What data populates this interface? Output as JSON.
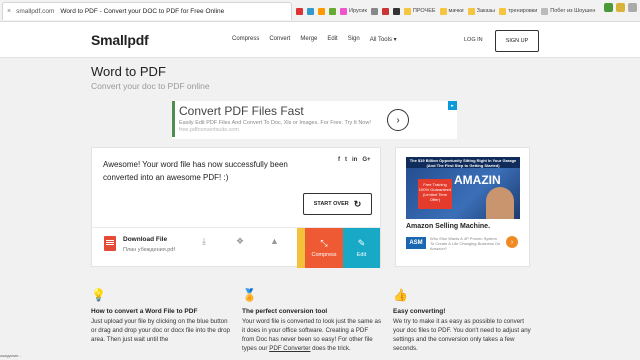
{
  "browser": {
    "tab_close": "×",
    "url": "smallpdf.com",
    "tab_title": "Word to PDF - Convert your DOC to PDF for Free Online",
    "bookmarks": [
      "Ирусик",
      "ПРОЧЕЕ",
      "мачки",
      "Заказы",
      "тренировки",
      "Побег из Шоушен"
    ]
  },
  "site": {
    "logo": "Smallpdf",
    "nav": [
      "Compress",
      "Convert",
      "Merge",
      "Edit",
      "Sign",
      "All Tools ▾"
    ],
    "login": "LOG IN",
    "signup": "SIGN UP"
  },
  "page": {
    "title": "Word to PDF",
    "subtitle": "Convert your doc to PDF online"
  },
  "ad": {
    "title": "Convert PDF Files Fast",
    "desc": "Easily Edit PDF Files And Convert To Doc, Xls or Images. For Free. Try It Now!",
    "source": "free.pdfconvertsuits.com",
    "badge": "▸"
  },
  "result": {
    "message": "Awesome! Your word file has now successfully been converted into an awesome PDF! :)",
    "share": [
      "f",
      "t",
      "in",
      "G+"
    ],
    "start_over": "START OVER",
    "download_label": "Download File",
    "file_name": "План убеждения.pdf",
    "compress": "Compress",
    "edit": "Edit"
  },
  "side_ad": {
    "banner": "The $19 Billion Opportunity Sitting Right In Your Garage (And The First Step to Getting Started)",
    "big_word": "AMAZIN",
    "offer": "Free Training 100% Guaranteed (Limited Time Offer)",
    "title": "Amazon Selling Machine.",
    "logo": "ASM",
    "desc": "Who Else Wants A 4P Proven System To Create A Life Changing Business On Amazon?"
  },
  "info": [
    {
      "icon": "lightbulb-icon",
      "heading": "How to convert a Word File to PDF",
      "text": "Just upload your file by clicking on the blue button or drag and drop your doc or docx file into the drop area. Then just wait until the"
    },
    {
      "icon": "award-icon",
      "heading": "The perfect conversion tool",
      "text": "Your word file is converted to look just the same as it does in your office software. Creating a PDF from Doc has never been so easy! For other file types our",
      "link": "PDF Converter",
      "text_after": " does the trick."
    },
    {
      "icon": "thumbs-up-icon",
      "heading": "Easy converting!",
      "text": "We try to make it as easy as possible to convert your doc files to PDF. You don't need to adjust any settings and the conversion only takes a few seconds."
    }
  ],
  "status": "ожидание..."
}
